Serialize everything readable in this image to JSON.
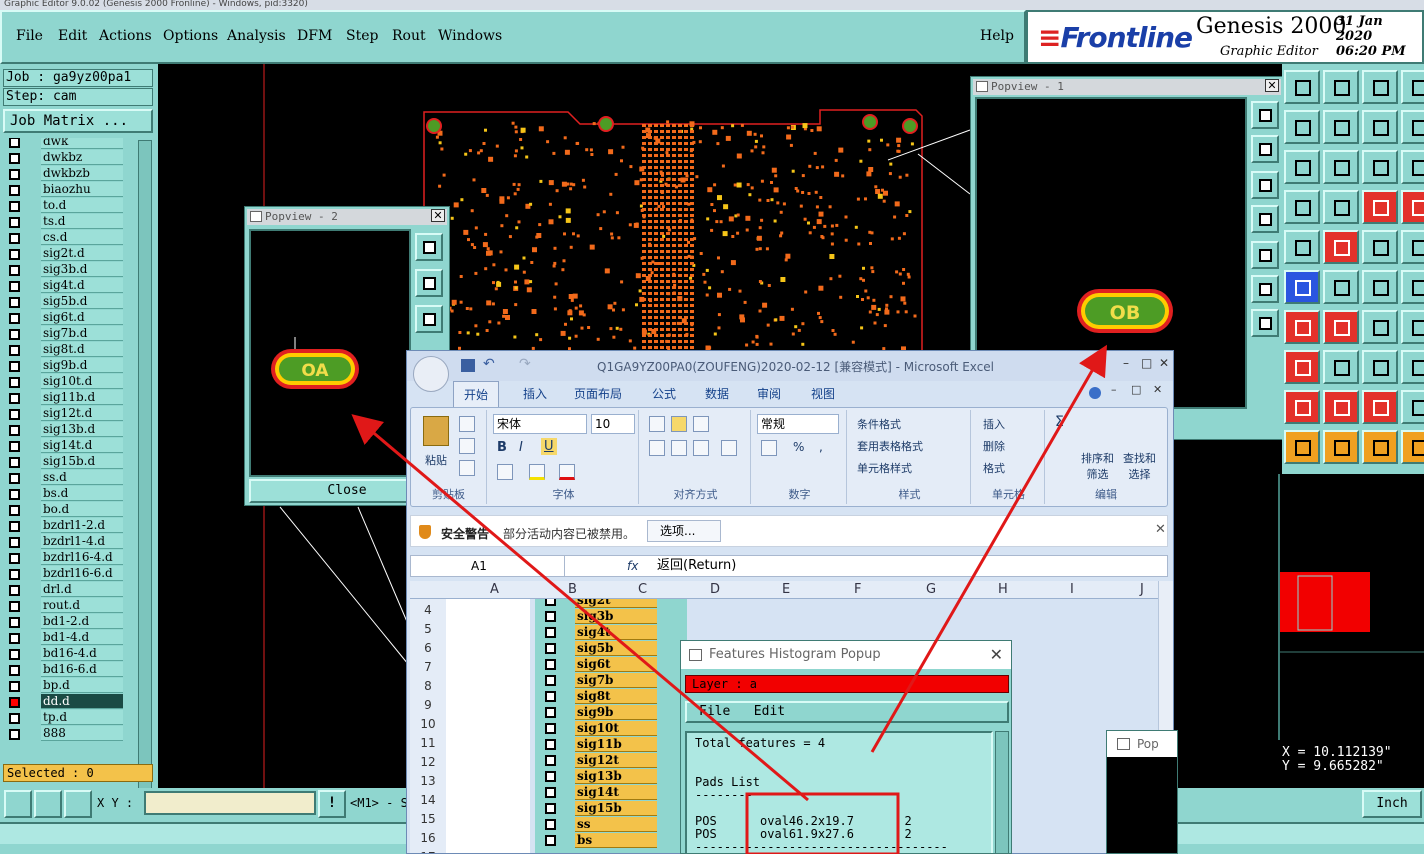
{
  "window": {
    "title_strip": "Graphic Editor 9.0.02 (Genesis 2000 Fronline) - Windows, pid:3320)"
  },
  "menu": {
    "items": [
      "File",
      "Edit",
      "Actions",
      "Options",
      "Analysis",
      "DFM",
      "Step",
      "Rout",
      "Windows"
    ],
    "help": "Help"
  },
  "brand": {
    "logo": "Frontline",
    "product": "Genesis 2000",
    "subtitle": "Graphic Editor",
    "date": "31 Jan 2020",
    "time": "06:20 PM"
  },
  "left": {
    "job": "Job : ga9yz00pa1",
    "step": "Step: cam",
    "job_matrix": "Job Matrix ...",
    "layers": [
      "dwk",
      "dwkbz",
      "dwkbzb",
      "biaozhu",
      "to.d",
      "ts.d",
      "cs.d",
      "sig2t.d",
      "sig3b.d",
      "sig4t.d",
      "sig5b.d",
      "sig6t.d",
      "sig7b.d",
      "sig8t.d",
      "sig9b.d",
      "sig10t.d",
      "sig11b.d",
      "sig12t.d",
      "sig13b.d",
      "sig14t.d",
      "sig15b.d",
      "ss.d",
      "bs.d",
      "bo.d",
      "bzdrl1-2.d",
      "bzdrl1-4.d",
      "bzdrl16-4.d",
      "bzdrl16-6.d",
      "drl.d",
      "rout.d",
      "bd1-2.d",
      "bd1-4.d",
      "bd16-4.d",
      "bd16-6.d",
      "bp.d",
      "dd.d",
      "tp.d",
      "888"
    ],
    "selected": "Selected : 0"
  },
  "popview2": {
    "title": "Popview - 2",
    "close_label": "Close",
    "pad_label": "OA"
  },
  "popview1": {
    "title": "Popview - 1",
    "pad_label": "OB"
  },
  "coords": {
    "x": "X  =  10.112139\"",
    "y": "Y  =   9.665282\""
  },
  "bottom": {
    "xy_label": "X Y :",
    "m1": "<M1> - S",
    "units": "Inch"
  },
  "excel": {
    "title": "Q1GA9YZ00PA0(ZOUFENG)2020-02-12  [兼容模式] - Microsoft Excel",
    "tabs": [
      "开始",
      "插入",
      "页面布局",
      "公式",
      "数据",
      "审阅",
      "视图"
    ],
    "ribbon": {
      "paste": "粘贴",
      "clipboard": "剪贴板",
      "font_name": "宋体",
      "font_size": "10",
      "font_group": "字体",
      "align_group": "对齐方式",
      "number_format": "常规",
      "number_group": "数字",
      "cond_format": "条件格式",
      "table_format": "套用表格格式",
      "cell_style": "单元格样式",
      "style_group": "样式",
      "insert": "插入",
      "delete": "删除",
      "format": "格式",
      "cells_group": "单元格",
      "sort": "排序和",
      "sort2": "筛选",
      "find": "查找和",
      "find2": "选择",
      "edit_group": "编辑"
    },
    "security": {
      "label": "安全警告",
      "message": "部分活动内容已被禁用。",
      "options": "选项..."
    },
    "namebox": "A1",
    "formula": "返回(Return)",
    "columns": [
      "A",
      "B",
      "C",
      "D",
      "E",
      "F",
      "G",
      "H",
      "I",
      "J"
    ],
    "rows": [
      "4",
      "5",
      "6",
      "7",
      "8",
      "9",
      "10",
      "11",
      "12",
      "13",
      "14",
      "15",
      "16",
      "17"
    ]
  },
  "inner_layers": [
    "sig2t",
    "sig3b",
    "sig4t",
    "sig5b",
    "sig6t",
    "sig7b",
    "sig8t",
    "sig9b",
    "sig10t",
    "sig11b",
    "sig12t",
    "sig13b",
    "sig14t",
    "sig15b",
    "ss",
    "bs"
  ],
  "histogram": {
    "title": "Features Histogram Popup",
    "layer": "Layer :   a",
    "menu_file": "File",
    "menu_edit": "Edit",
    "body": "Total features = 4\n\n\nPads List\n--------\n\nPOS      oval46.2x19.7       2\nPOS      oval61.9x27.6       2\n-----------------------------------"
  },
  "pop3_title": "Pop",
  "colors": {
    "teal": "#8fd6cf",
    "pad_fill": "#4d9c25",
    "pad_outline": "#ffcc00",
    "annotation": "#e01818"
  }
}
